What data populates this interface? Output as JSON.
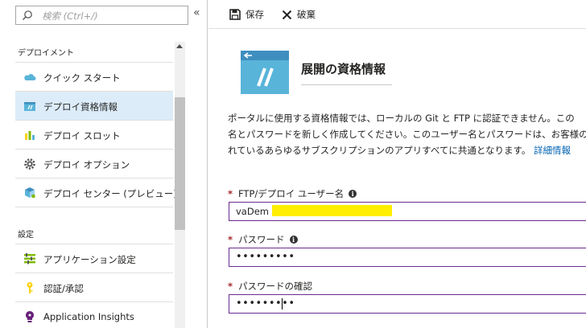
{
  "search": {
    "placeholder": "検索 (Ctrl+/)"
  },
  "menu": {
    "section_deploy": "デプロイメント",
    "section_settings": "設定",
    "items": [
      {
        "label": "クイック スタート",
        "icon": "cloud-icon"
      },
      {
        "label": "デプロイ資格情報",
        "icon": "credentials-icon"
      },
      {
        "label": "デプロイ スロット",
        "icon": "slots-icon"
      },
      {
        "label": "デプロイ オプション",
        "icon": "gear-icon"
      },
      {
        "label": "デプロイ センター (プレビュー)",
        "icon": "deployment-center-icon"
      },
      {
        "label": "アプリケーション設定",
        "icon": "app-settings-icon"
      },
      {
        "label": "認証/承認",
        "icon": "key-icon"
      },
      {
        "label": "Application Insights",
        "icon": "lightbulb-icon"
      }
    ]
  },
  "toolbar": {
    "save_label": "保存",
    "discard_label": "破棄"
  },
  "page": {
    "title": "展開の資格情報",
    "desc_line1": "ポータルに使用する資格情報では、ローカルの Git と FTP に認証できません。この",
    "desc_line2": "名とパスワードを新しく作成してください。このユーザー名とパスワードは、お客様の N",
    "desc_line3": "れているあらゆるサブスクリプションのアプリすべてに共通となります。",
    "more_info_link": "詳細情報"
  },
  "form": {
    "required_mark": "*",
    "info_glyph": "i",
    "username_label": "FTP/デプロイ ユーザー名",
    "username_value": "vaDem",
    "password_label": "パスワード",
    "password_value": "•••••••••",
    "confirm_label": "パスワードの確認",
    "confirm_value": "•••••••••"
  },
  "colors": {
    "accent": "#0078d4",
    "selected_bg": "#dcecf9",
    "field_border": "#6b2c91",
    "required": "#a4262c",
    "redaction": "#ffee00"
  }
}
